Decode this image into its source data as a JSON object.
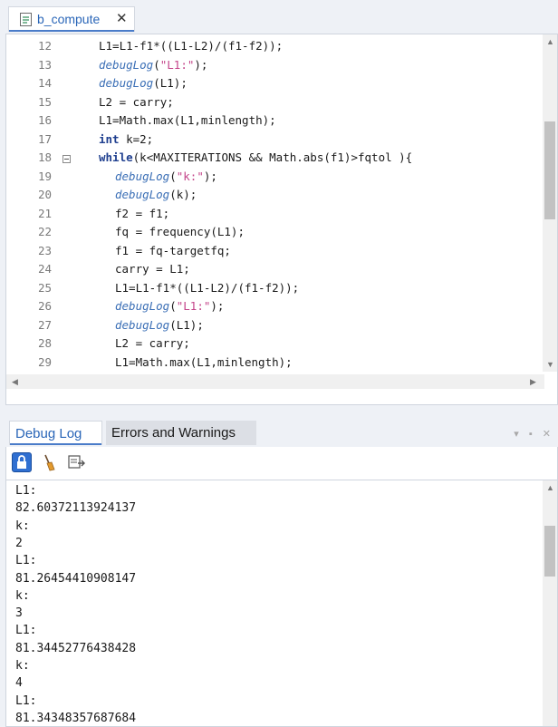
{
  "editor_tab": {
    "label": "b_compute",
    "close": "✕",
    "icon": "file-code-icon"
  },
  "code_lines": [
    {
      "n": "12",
      "segs": [
        {
          "t": "L1=L1-f1*((L1-L2)/(f1-f2));",
          "c": ""
        }
      ],
      "indent": 1
    },
    {
      "n": "13",
      "segs": [
        {
          "t": "debugLog",
          "c": "fn"
        },
        {
          "t": "(",
          "c": ""
        },
        {
          "t": "\"L1:\"",
          "c": "str"
        },
        {
          "t": ");",
          "c": ""
        }
      ],
      "indent": 1
    },
    {
      "n": "14",
      "segs": [
        {
          "t": "debugLog",
          "c": "fn"
        },
        {
          "t": "(L1);",
          "c": ""
        }
      ],
      "indent": 1
    },
    {
      "n": "15",
      "segs": [
        {
          "t": "L2 = carry;",
          "c": ""
        }
      ],
      "indent": 1
    },
    {
      "n": "16",
      "segs": [
        {
          "t": "L1=Math.max(L1,minlength);",
          "c": ""
        }
      ],
      "indent": 1
    },
    {
      "n": "17",
      "segs": [
        {
          "t": "int",
          "c": "kw"
        },
        {
          "t": " k=2;",
          "c": ""
        }
      ],
      "indent": 1
    },
    {
      "n": "18",
      "segs": [
        {
          "t": "while",
          "c": "kw"
        },
        {
          "t": "(k<MAXITERATIONS && Math.abs(f1)>fqtol ){",
          "c": ""
        }
      ],
      "indent": 1
    },
    {
      "n": "19",
      "segs": [
        {
          "t": "debugLog",
          "c": "fn"
        },
        {
          "t": "(",
          "c": ""
        },
        {
          "t": "\"k:\"",
          "c": "str"
        },
        {
          "t": ");",
          "c": ""
        }
      ],
      "indent": 2
    },
    {
      "n": "20",
      "segs": [
        {
          "t": "debugLog",
          "c": "fn"
        },
        {
          "t": "(k);",
          "c": ""
        }
      ],
      "indent": 2
    },
    {
      "n": "21",
      "segs": [
        {
          "t": "f2 = f1;",
          "c": ""
        }
      ],
      "indent": 2
    },
    {
      "n": "22",
      "segs": [
        {
          "t": "fq = frequency(L1);",
          "c": ""
        }
      ],
      "indent": 2
    },
    {
      "n": "23",
      "segs": [
        {
          "t": "f1 = fq-targetfq;",
          "c": ""
        }
      ],
      "indent": 2
    },
    {
      "n": "24",
      "segs": [
        {
          "t": "carry = L1;",
          "c": ""
        }
      ],
      "indent": 2
    },
    {
      "n": "25",
      "segs": [
        {
          "t": "L1=L1-f1*((L1-L2)/(f1-f2));",
          "c": ""
        }
      ],
      "indent": 2
    },
    {
      "n": "26",
      "segs": [
        {
          "t": "debugLog",
          "c": "fn"
        },
        {
          "t": "(",
          "c": ""
        },
        {
          "t": "\"L1:\"",
          "c": "str"
        },
        {
          "t": ");",
          "c": ""
        }
      ],
      "indent": 2
    },
    {
      "n": "27",
      "segs": [
        {
          "t": "debugLog",
          "c": "fn"
        },
        {
          "t": "(L1);",
          "c": ""
        }
      ],
      "indent": 2
    },
    {
      "n": "28",
      "segs": [
        {
          "t": "L2 = carry;",
          "c": ""
        }
      ],
      "indent": 2
    },
    {
      "n": "29",
      "segs": [
        {
          "t": "L1=Math.max(L1,minlength);",
          "c": ""
        }
      ],
      "indent": 2
    }
  ],
  "panel": {
    "tabs": [
      {
        "label": "Debug Log",
        "active": true
      },
      {
        "label": "Errors and Warnings",
        "active": false
      }
    ],
    "controls": "▾ ▪ ✕",
    "toolbar_icons": [
      "lock-icon",
      "broom-clear-icon",
      "export-icon"
    ]
  },
  "log_lines": [
    "L1:",
    "82.60372113924137",
    "k:",
    "2",
    "L1:",
    "81.26454410908147",
    "k:",
    "3",
    "L1:",
    "81.34452776438428",
    "k:",
    "4",
    "L1:",
    "81.34348357687684"
  ],
  "colors": {
    "accent": "#4a7cc9",
    "function": "#3b6fb6",
    "string": "#c4458a",
    "keyword": "#1f3f8f"
  }
}
